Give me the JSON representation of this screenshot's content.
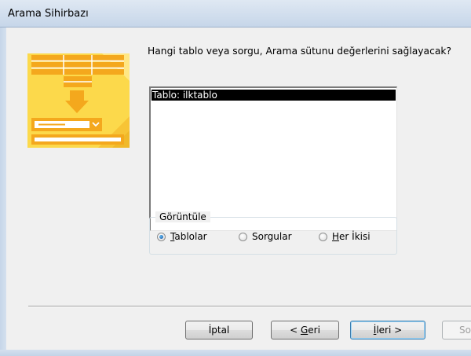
{
  "window": {
    "title": "Arama Sihirbazı"
  },
  "wizard": {
    "question": "Hangi tablo veya sorgu, Arama sütunu değerlerini sağlayacak?",
    "list": {
      "items": [
        {
          "label": "Tablo: ilktablo",
          "selected": true
        }
      ]
    },
    "view_group": {
      "label": "Görüntüle",
      "options": [
        {
          "mnemonic": "T",
          "rest": "ablolar",
          "selected": true
        },
        {
          "mnemonic": "",
          "rest": "Sorgular",
          "selected": false
        },
        {
          "mnemonic": "H",
          "rest": "er İkisi",
          "selected": false
        }
      ]
    }
  },
  "buttons": {
    "cancel": {
      "label": "İptal"
    },
    "back": {
      "prefix": "< ",
      "mnemonic": "G",
      "rest": "eri"
    },
    "next": {
      "mnemonic": "İ",
      "rest": "leri >"
    },
    "finish": {
      "label": "So"
    }
  },
  "colors": {
    "selection_bg": "#000000",
    "selection_fg": "#ffffff",
    "art_yellow": "#fcd94b",
    "art_orange": "#f4a81d",
    "default_button_border": "#3c7fb1"
  }
}
